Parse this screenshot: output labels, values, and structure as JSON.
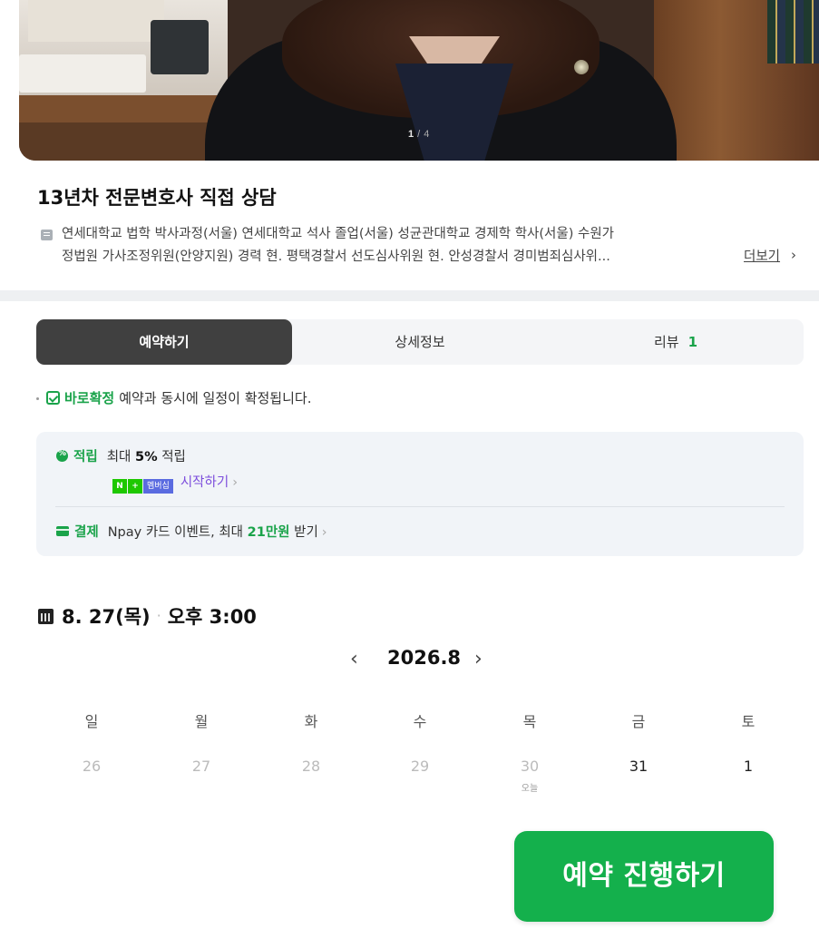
{
  "hero": {
    "counter_current": "1",
    "counter_total": " / 4"
  },
  "title": "13년차 전문변호사 직접 상담",
  "bio": {
    "line1": "연세대학교 법학 박사과정(서울) 연세대학교 석사 졸업(서울) 성균관대학교 경제학 학사(서울) 수원가",
    "line2": "정법원 가사조정위원(안양지원) 경력 현. 평택경찰서 선도심사위원 현. 안성경찰서 경미범죄심사위...",
    "more_label": "더보기"
  },
  "tabs": [
    {
      "label": "예약하기",
      "active": true
    },
    {
      "label": "상세정보",
      "active": false
    },
    {
      "label": "리뷰",
      "count": "1",
      "active": false
    }
  ],
  "confirm": {
    "strong": "바로확정",
    "text": "예약과 동시에 일정이 확정됩니다."
  },
  "benefit": {
    "reward_label": "적립",
    "reward_prefix": "최대 ",
    "reward_value": "5%",
    "reward_suffix": " 적립",
    "badge_n": "N",
    "badge_plus": "+",
    "badge_m": "멤버십",
    "start_label": "시작하기",
    "pay_label": "결제",
    "pay_prefix": "Npay 카드 이벤트, 최대 ",
    "pay_value": "21만원",
    "pay_suffix": " 받기"
  },
  "selected": {
    "date": "8. 27(목)",
    "sep": "·",
    "time": "오후 3:00"
  },
  "calendar": {
    "month": "2026.8",
    "weekdays": [
      "일",
      "월",
      "화",
      "수",
      "목",
      "금",
      "토"
    ],
    "days": [
      {
        "label": "26",
        "active": false
      },
      {
        "label": "27",
        "active": false
      },
      {
        "label": "28",
        "active": false
      },
      {
        "label": "29",
        "active": false
      },
      {
        "label": "30",
        "active": false
      },
      {
        "label": "31",
        "active": true
      },
      {
        "label": "1",
        "active": true
      }
    ],
    "today_label": "오늘"
  },
  "cta": {
    "label": "예약 진행하기"
  },
  "colors": {
    "accent_green": "#14b04c",
    "tab_active": "#404040",
    "membership_purple": "#7c4ddc"
  }
}
